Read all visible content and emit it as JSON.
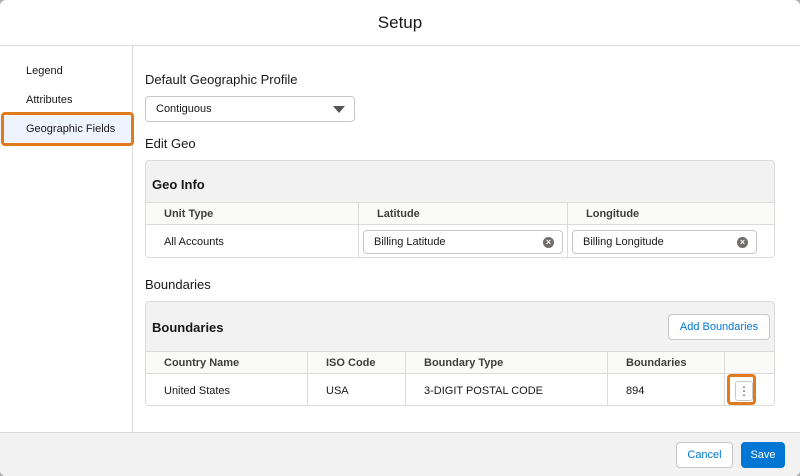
{
  "header": {
    "title": "Setup"
  },
  "sidebar": {
    "items": [
      {
        "label": "Legend"
      },
      {
        "label": "Attributes"
      },
      {
        "label": "Geographic Fields"
      }
    ]
  },
  "main": {
    "default_profile": {
      "label": "Default Geographic Profile",
      "selected": "Contiguous"
    },
    "edit_geo_label": "Edit Geo",
    "geo_info": {
      "title": "Geo Info",
      "columns": [
        "Unit Type",
        "Latitude",
        "Longitude"
      ],
      "row": {
        "unit_type": "All Accounts",
        "latitude": "Billing Latitude",
        "longitude": "Billing Longitude"
      }
    },
    "boundaries_label": "Boundaries",
    "boundaries": {
      "title": "Boundaries",
      "add_button": "Add Boundaries",
      "columns": [
        "Country Name",
        "ISO Code",
        "Boundary Type",
        "Boundaries"
      ],
      "rows": [
        {
          "country": "United States",
          "iso": "USA",
          "type": "3-DIGIT POSTAL CODE",
          "count": "894"
        }
      ]
    }
  },
  "footer": {
    "cancel_label": "Cancel",
    "save_label": "Save"
  },
  "colors": {
    "highlight": "#e07b1d",
    "brand": "#0176d3",
    "active_bg": "#eef4ff"
  },
  "icons": {
    "clear": "clear-icon",
    "dropdown": "chevron-down-icon",
    "row_menu": "more-vertical-icon"
  }
}
